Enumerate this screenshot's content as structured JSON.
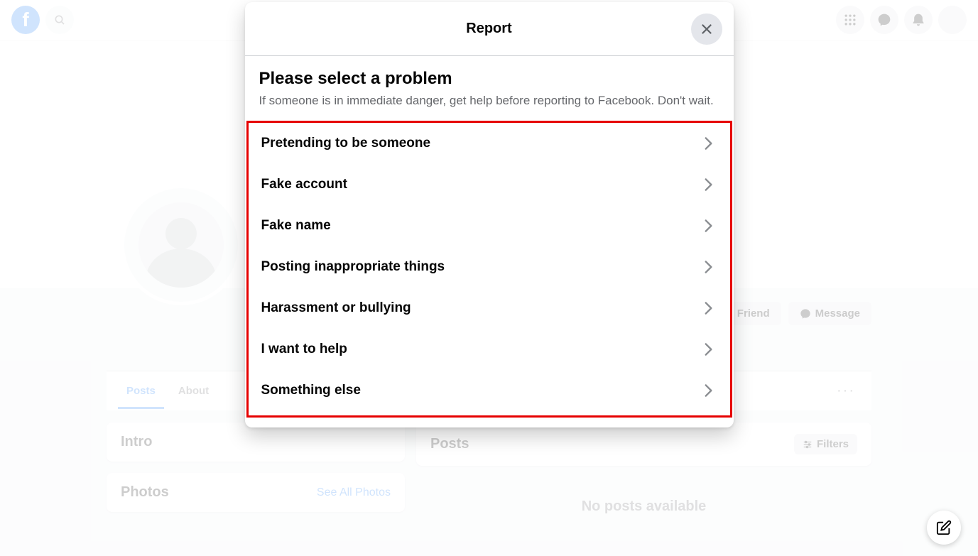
{
  "header": {
    "logo_letter": "f"
  },
  "profile": {
    "actions": {
      "add_friend": "Add Friend",
      "message": "Message"
    },
    "tabs": {
      "posts": "Posts",
      "about": "About"
    }
  },
  "content": {
    "intro_title": "Intro",
    "photos_title": "Photos",
    "see_all_photos": "See All Photos",
    "posts_title": "Posts",
    "filters": "Filters",
    "no_posts": "No posts available"
  },
  "modal": {
    "title": "Report",
    "heading": "Please select a problem",
    "subtext": "If someone is in immediate danger, get help before reporting to Facebook. Don't wait.",
    "options": [
      "Pretending to be someone",
      "Fake account",
      "Fake name",
      "Posting inappropriate things",
      "Harassment or bullying",
      "I want to help",
      "Something else"
    ]
  }
}
